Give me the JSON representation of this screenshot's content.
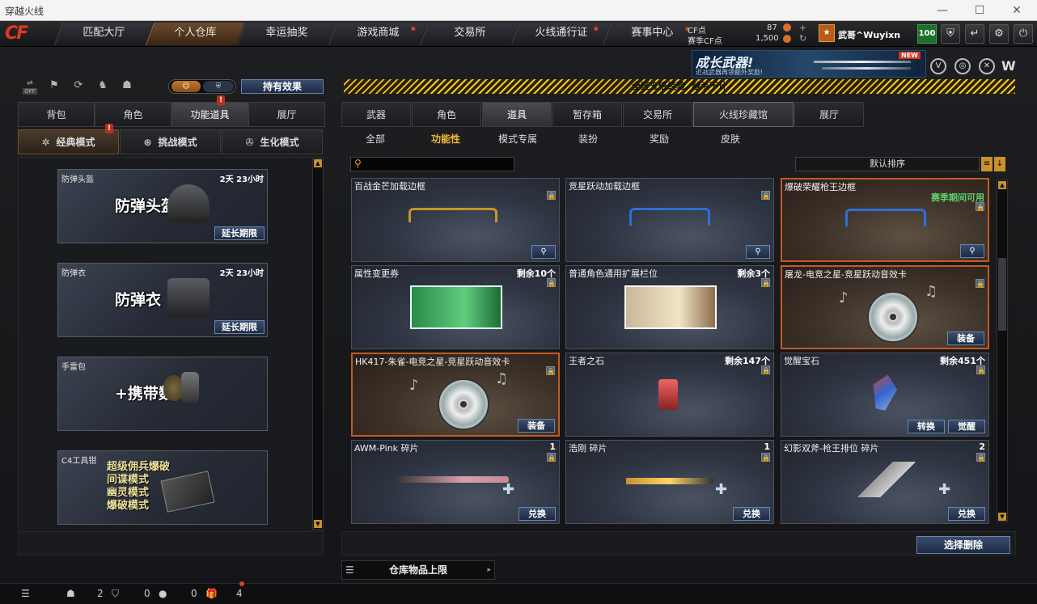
{
  "window": {
    "title": "穿越火线",
    "min": "—",
    "max": "☐",
    "close": "✕"
  },
  "nav": {
    "logo": "CF",
    "tabs": [
      {
        "label": "匹配大厅",
        "active": false,
        "dot": false
      },
      {
        "label": "个人仓库",
        "active": true,
        "dot": false
      },
      {
        "label": "幸运抽奖",
        "active": false,
        "dot": false
      },
      {
        "label": "游戏商城",
        "active": false,
        "dot": true
      },
      {
        "label": "交易所",
        "active": false,
        "dot": false
      },
      {
        "label": "火线通行证",
        "active": false,
        "dot": true
      },
      {
        "label": "赛事中心",
        "active": false,
        "dot": true
      }
    ],
    "cf_label": "CF点",
    "cf_value": "87",
    "scf_label": "赛季CF点",
    "scf_value": "1,500",
    "username": "武哥^Wuyixn",
    "level": "100"
  },
  "banner": {
    "title": "成长武器!",
    "subtitle": "近战武器再领额外奖励!",
    "new_badge": "NEW"
  },
  "left": {
    "toggle_off": "OFF",
    "hold_effect": "持有效果",
    "tabs": [
      {
        "label": "背包",
        "active": false
      },
      {
        "label": "角色",
        "active": false
      },
      {
        "label": "功能道具",
        "active": true
      },
      {
        "label": "展厅",
        "active": false
      }
    ],
    "modes": [
      {
        "label": "经典模式",
        "active": true
      },
      {
        "label": "挑战模式",
        "active": false
      },
      {
        "label": "生化模式",
        "active": false
      }
    ],
    "items": [
      {
        "name": "防弹头盔",
        "time": "2天 23小时",
        "art": "防弹头盔",
        "button": "延长期限"
      },
      {
        "name": "防弹衣",
        "time": "2天 23小时",
        "art": "防弹衣",
        "button": "延长期限"
      },
      {
        "name": "手雷包",
        "time": "",
        "art": "+携带数",
        "button": ""
      },
      {
        "name": "C4工具钳",
        "time": "",
        "art_lines": [
          "超级佣兵爆破",
          "间谍模式",
          "幽灵模式",
          "爆破模式"
        ],
        "button": ""
      }
    ]
  },
  "ticker": "全区五倍经验, 越杀不计",
  "right": {
    "tabs": [
      {
        "label": "武器"
      },
      {
        "label": "角色"
      },
      {
        "label": "道具",
        "active": true
      },
      {
        "label": "暂存箱"
      },
      {
        "label": "交易所"
      },
      {
        "label": "火线珍藏馆",
        "coll": true
      },
      {
        "label": "展厅"
      }
    ],
    "subtabs": [
      {
        "label": "全部"
      },
      {
        "label": "功能性",
        "active": true
      },
      {
        "label": "模式专属"
      },
      {
        "label": "装扮"
      },
      {
        "label": "奖励"
      },
      {
        "label": "皮肤"
      }
    ],
    "sort": "默认排序",
    "cards": [
      {
        "name": "百战金芒加载边框",
        "count": "",
        "note": "",
        "sel": false,
        "buttons": [],
        "mag": true
      },
      {
        "name": "竞星跃动加载边框",
        "count": "",
        "note": "",
        "sel": false,
        "buttons": [],
        "mag": true
      },
      {
        "name": "爆破荣耀枪王边框",
        "count": "",
        "note": "赛季期间可用",
        "sel": true,
        "buttons": [],
        "mag": true
      },
      {
        "name": "属性变更券",
        "count": "剩余10个",
        "note": "",
        "sel": false,
        "buttons": [],
        "mag": false
      },
      {
        "name": "普通角色通用扩展栏位",
        "count": "剩余3个",
        "note": "",
        "sel": false,
        "buttons": [],
        "mag": false
      },
      {
        "name": "屠龙-电竞之星-竞星跃动音效卡",
        "count": "",
        "note": "",
        "sel": true,
        "buttons": [
          "装备"
        ],
        "mag": false
      },
      {
        "name": "HK417-朱雀-电竞之星-竞星跃动音效卡",
        "count": "",
        "note": "",
        "sel": true,
        "buttons": [
          "装备"
        ],
        "mag": false
      },
      {
        "name": "王者之石",
        "count": "剩余147个",
        "note": "",
        "sel": false,
        "buttons": [],
        "mag": false
      },
      {
        "name": "觉醒宝石",
        "count": "剩余451个",
        "note": "",
        "sel": false,
        "buttons": [
          "转换",
          "觉醒"
        ],
        "mag": false
      },
      {
        "name": "AWM-Pink 碎片",
        "count": "1",
        "note": "",
        "sel": false,
        "buttons": [
          "兑换"
        ],
        "mag": false
      },
      {
        "name": "浩刚 碎片",
        "count": "1",
        "note": "",
        "sel": false,
        "buttons": [
          "兑换"
        ],
        "mag": false
      },
      {
        "name": "幻影双斧-枪王排位 碎片",
        "count": "2",
        "note": "",
        "sel": false,
        "buttons": [
          "兑换"
        ],
        "mag": false
      }
    ],
    "select_delete": "选择删除",
    "storage_limit": "仓库物品上限"
  },
  "status": {
    "v1": "2",
    "v2": "0",
    "v3": "0",
    "v4": "4"
  },
  "colors": {
    "accent": "#c9922e",
    "selected_border": "#c45a22",
    "ticker": "#f3c62c"
  }
}
